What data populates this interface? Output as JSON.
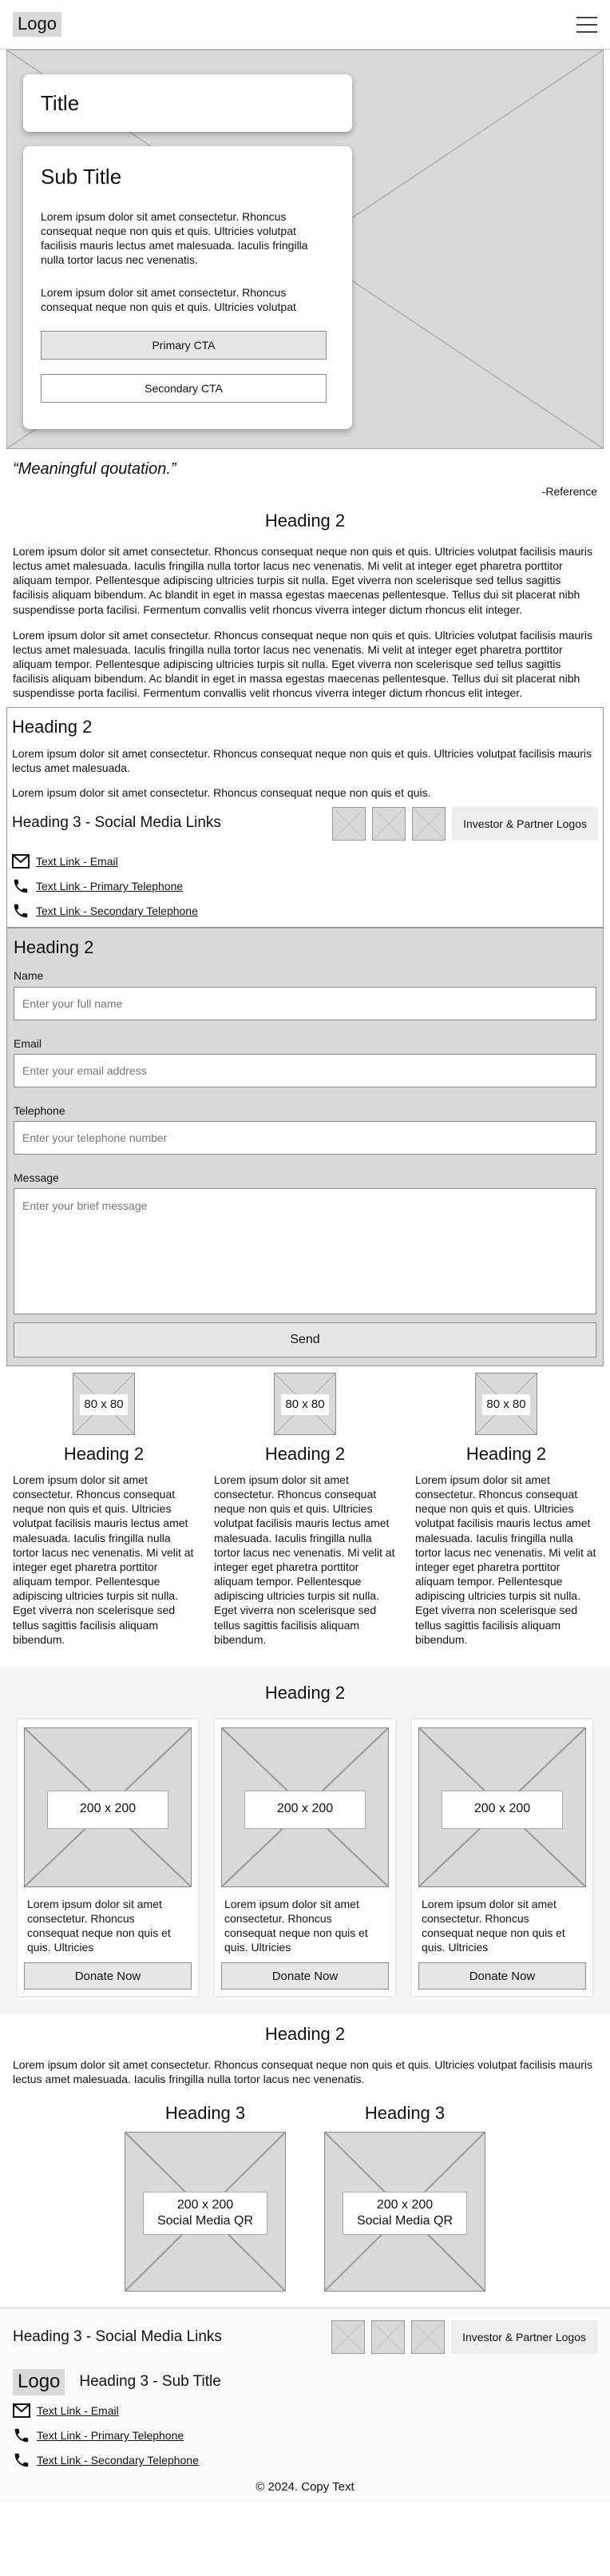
{
  "header": {
    "logo": "Logo",
    "menu_icon": "hamburger-menu-icon"
  },
  "hero": {
    "title": "Title",
    "subtitle": "Sub Title",
    "paragraphs": [
      "Lorem ipsum dolor sit amet consectetur. Rhoncus consequat neque non quis et quis. Ultricies volutpat facilisis mauris lectus amet malesuada. Iaculis fringilla nulla tortor lacus nec venenatis.",
      "Lorem ipsum dolor sit amet consectetur. Rhoncus consequat neque non quis et quis. Ultricies volutpat"
    ],
    "primary_cta": "Primary CTA",
    "secondary_cta": "Secondary CTA"
  },
  "quote": {
    "text": "“Meaningful qoutation.”",
    "reference": "-Reference"
  },
  "intro": {
    "heading": "Heading 2",
    "paragraphs": [
      "Lorem ipsum dolor sit amet consectetur. Rhoncus consequat neque non quis et quis. Ultricies volutpat facilisis mauris lectus amet malesuada. Iaculis fringilla nulla tortor lacus nec venenatis. Mi velit at integer eget pharetra porttitor aliquam tempor. Pellentesque adipiscing ultricies turpis sit nulla. Eget viverra non scelerisque sed tellus sagittis facilisis aliquam bibendum. Ac blandit in eget in massa egestas maecenas pellentesque. Tellus dui sit placerat nibh suspendisse porta facilisi. Fermentum convallis velit rhoncus viverra integer dictum rhoncus elit integer.",
      "Lorem ipsum dolor sit amet consectetur. Rhoncus consequat neque non quis et quis. Ultricies volutpat facilisis mauris lectus amet malesuada. Iaculis fringilla nulla tortor lacus nec venenatis. Mi velit at integer eget pharetra porttitor aliquam tempor. Pellentesque adipiscing ultricies turpis sit nulla. Eget viverra non scelerisque sed tellus sagittis facilisis aliquam bibendum. Ac blandit in eget in massa egestas maecenas pellentesque. Tellus dui sit placerat nibh suspendisse porta facilisi. Fermentum convallis velit rhoncus viverra integer dictum rhoncus elit integer."
    ]
  },
  "social": {
    "heading": "Heading 2",
    "paragraphs": [
      "Lorem ipsum dolor sit amet consectetur. Rhoncus consequat neque non quis et quis. Ultricies volutpat facilisis mauris lectus amet malesuada.",
      "Lorem ipsum dolor sit amet consectetur. Rhoncus consequat neque non quis et quis."
    ],
    "social_heading": "Heading 3 - Social Media Links",
    "partner": "Investor & Partner Logos",
    "links": [
      {
        "icon": "mail-icon",
        "text": "Text Link - Email"
      },
      {
        "icon": "phone-icon",
        "text": "Text Link - Primary Telephone"
      },
      {
        "icon": "phone-icon",
        "text": "Text Link - Secondary Telephone"
      }
    ]
  },
  "form": {
    "heading": "Heading 2",
    "name_label": "Name",
    "name_placeholder": "Enter your full name",
    "email_label": "Email",
    "email_placeholder": "Enter your email address",
    "phone_label": "Telephone",
    "phone_placeholder": "Enter your telephone number",
    "message_label": "Message",
    "message_placeholder": "Enter your brief message",
    "send": "Send"
  },
  "columns": [
    {
      "img": "80 x 80",
      "heading": "Heading 2",
      "text": "Lorem ipsum dolor sit amet consectetur. Rhoncus consequat neque non quis et quis. Ultricies volutpat facilisis mauris lectus amet malesuada. Iaculis fringilla nulla tortor lacus nec venenatis. Mi velit at integer eget pharetra porttitor aliquam tempor. Pellentesque adipiscing ultricies turpis sit nulla. Eget viverra non scelerisque sed tellus sagittis facilisis aliquam bibendum."
    },
    {
      "img": "80 x 80",
      "heading": "Heading 2",
      "text": "Lorem ipsum dolor sit amet consectetur. Rhoncus consequat neque non quis et quis. Ultricies volutpat facilisis mauris lectus amet malesuada. Iaculis fringilla nulla tortor lacus nec venenatis. Mi velit at integer eget pharetra porttitor aliquam tempor. Pellentesque adipiscing ultricies turpis sit nulla. Eget viverra non scelerisque sed tellus sagittis facilisis aliquam bibendum."
    },
    {
      "img": "80 x 80",
      "heading": "Heading 2",
      "text": "Lorem ipsum dolor sit amet consectetur. Rhoncus consequat neque non quis et quis. Ultricies volutpat facilisis mauris lectus amet malesuada. Iaculis fringilla nulla tortor lacus nec venenatis. Mi velit at integer eget pharetra porttitor aliquam tempor. Pellentesque adipiscing ultricies turpis sit nulla. Eget viverra non scelerisque sed tellus sagittis facilisis aliquam bibendum."
    }
  ],
  "donate": {
    "heading": "Heading 2",
    "cards": [
      {
        "img": "200 x 200",
        "text": "Lorem ipsum dolor sit amet consectetur. Rhoncus consequat neque non quis et quis. Ultricies",
        "button": "Donate Now"
      },
      {
        "img": "200 x 200",
        "text": "Lorem ipsum dolor sit amet consectetur. Rhoncus consequat neque non quis et quis. Ultricies",
        "button": "Donate Now"
      },
      {
        "img": "200 x 200",
        "text": "Lorem ipsum dolor sit amet consectetur. Rhoncus consequat neque non quis et quis. Ultricies",
        "button": "Donate Now"
      }
    ]
  },
  "qr": {
    "heading": "Heading 2",
    "text": "Lorem ipsum dolor sit amet consectetur. Rhoncus consequat neque non quis et quis. Ultricies volutpat facilisis mauris lectus amet malesuada. Iaculis fringilla nulla tortor lacus nec venenatis.",
    "items": [
      {
        "heading": "Heading 3",
        "size": "200 x 200",
        "label": "Social Media QR"
      },
      {
        "heading": "Heading 3",
        "size": "200 x 200",
        "label": "Social Media QR"
      }
    ]
  },
  "footer": {
    "social_heading": "Heading 3 - Social Media Links",
    "partner": "Investor & Partner Logos",
    "logo": "Logo",
    "sub_title": "Heading 3 - Sub Title",
    "links": [
      {
        "icon": "mail-icon",
        "text": "Text Link - Email"
      },
      {
        "icon": "phone-icon",
        "text": "Text Link - Primary Telephone"
      },
      {
        "icon": "phone-icon",
        "text": "Text Link - Secondary Telephone"
      }
    ],
    "copyright": "© 2024. Copy Text"
  },
  "colors": {
    "placeholder_fill": "#d9d9d9",
    "border": "#888888",
    "button_fill": "#e6e6e6"
  }
}
